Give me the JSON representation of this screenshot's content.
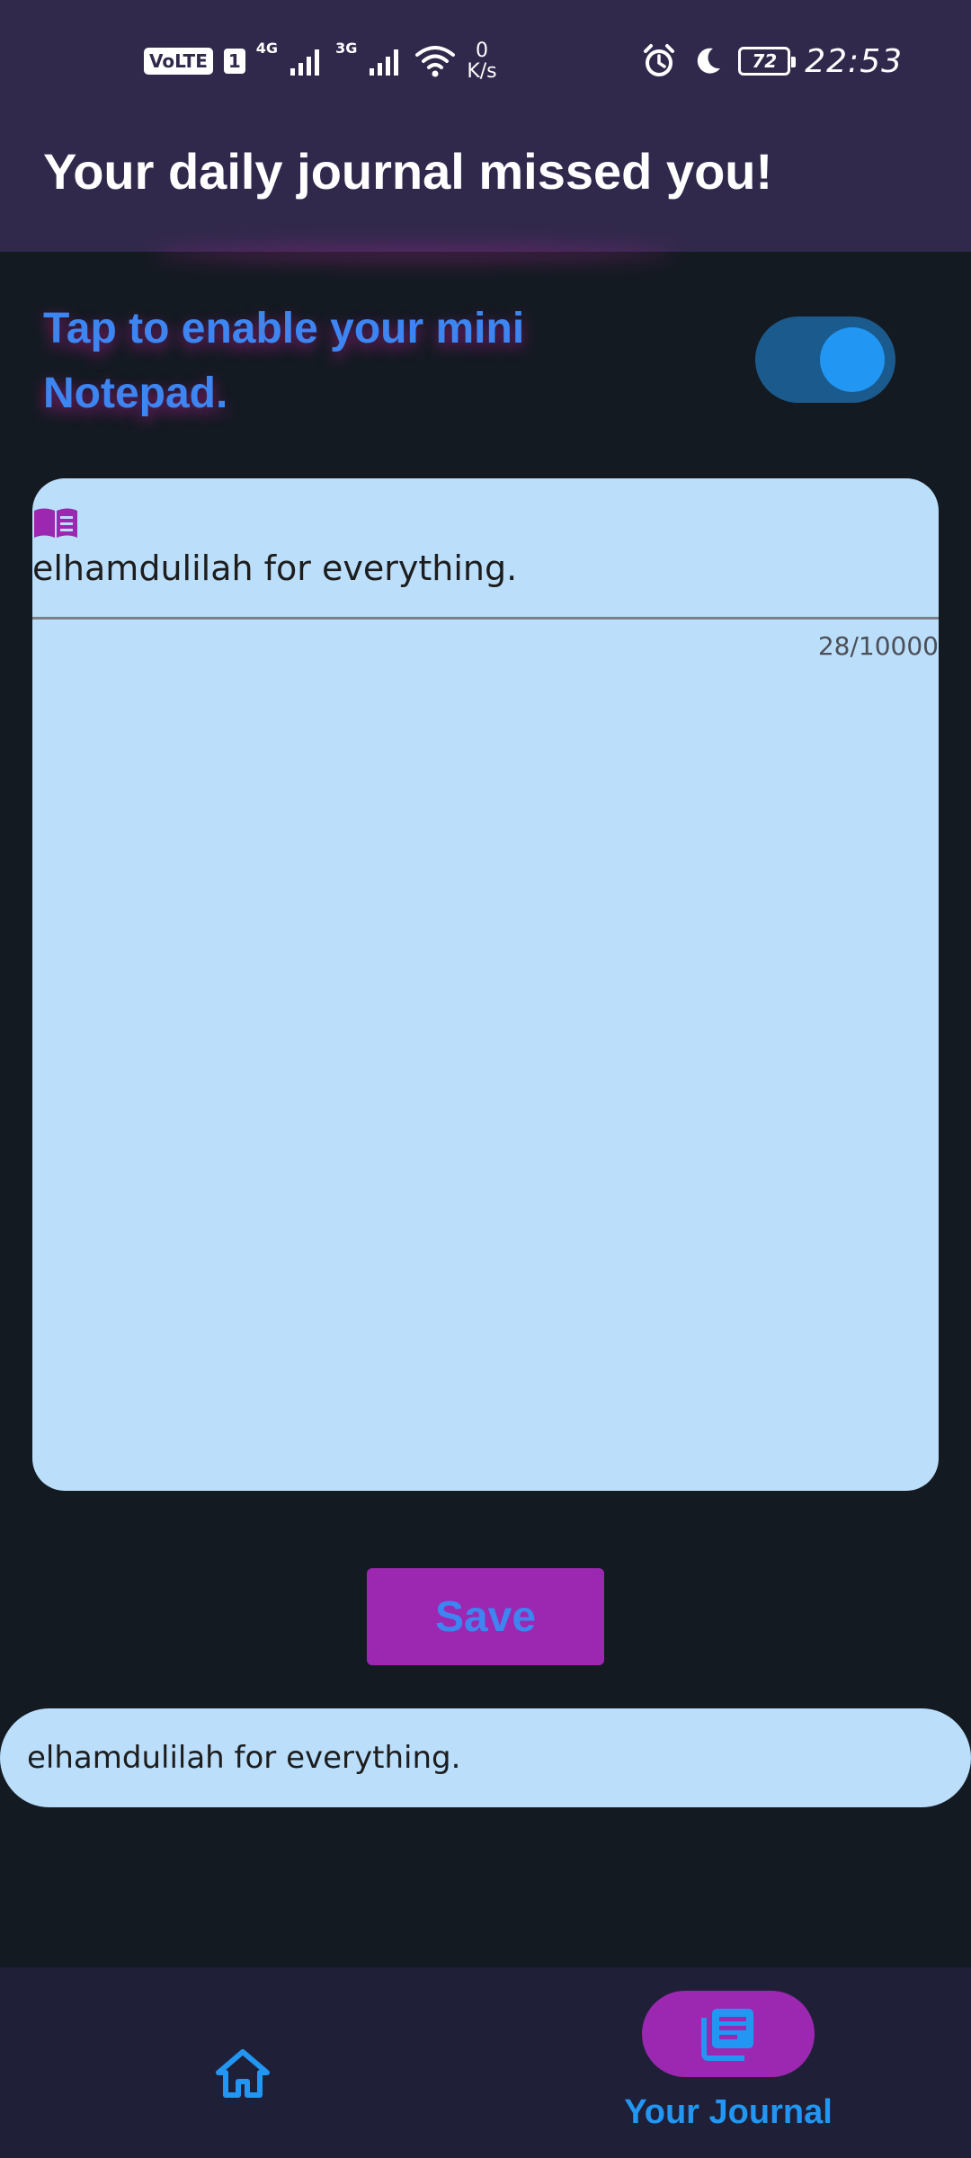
{
  "status_bar": {
    "volte": "VoLTE",
    "sim": "1",
    "net1": "4G",
    "net2": "3G",
    "speed_value": "0",
    "speed_unit": "K/s",
    "battery": "72",
    "time": "22:53"
  },
  "app_bar": {
    "title": "Your daily journal missed you!"
  },
  "toggle_row": {
    "label": "Tap to enable your mini Notepad.",
    "enabled": true
  },
  "editor": {
    "value": "elhamdulilah for everything.",
    "counter": "28/10000"
  },
  "save_button": {
    "label": "Save"
  },
  "entries": [
    {
      "text": "elhamdulilah for everything."
    }
  ],
  "bottom_nav": {
    "items": [
      {
        "label": "",
        "icon": "home-icon",
        "selected": false
      },
      {
        "label": "Your Journal",
        "icon": "journal-icon",
        "selected": true
      }
    ]
  },
  "colors": {
    "background": "#141a22",
    "app_bar": "#31294c",
    "accent_blue": "#2196f3",
    "accent_purple": "#9c27b0",
    "card": "#bbdefb",
    "nav": "#1f2038"
  }
}
